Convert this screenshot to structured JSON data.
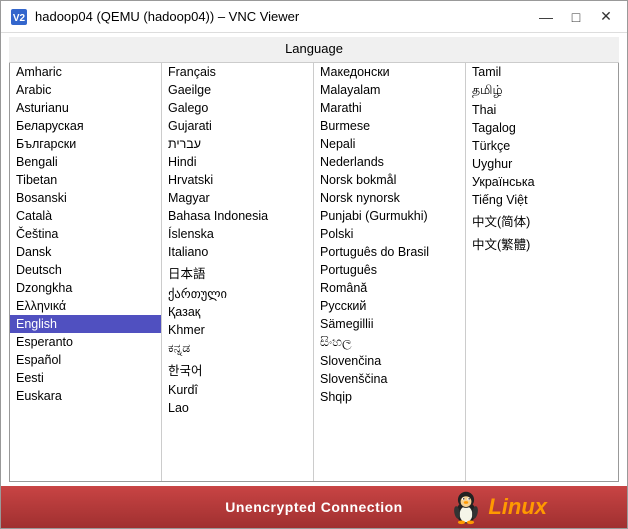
{
  "window": {
    "title": "hadoop04 (QEMU (hadoop04)) – VNC Viewer",
    "icon": "vnc-icon"
  },
  "title_buttons": {
    "minimize": "—",
    "maximize": "□",
    "close": "✕"
  },
  "language_header": "Language",
  "status": {
    "text": "Unencrypted Connection"
  },
  "columns": [
    {
      "items": [
        "Amharic",
        "Arabic",
        "Asturianu",
        "Беларуская",
        "Български",
        "Bengali",
        "Tibetan",
        "Bosanski",
        "Català",
        "Čeština",
        "Dansk",
        "Deutsch",
        "Dzongkha",
        "Ελληνικά",
        "English",
        "Esperanto",
        "Español",
        "Eesti",
        "Euskara"
      ]
    },
    {
      "items": [
        "Français",
        "Gaeilge",
        "Galego",
        "Gujarati",
        "עברית",
        "Hindi",
        "Hrvatski",
        "Magyar",
        "Bahasa Indonesia",
        "Íslenska",
        "Italiano",
        "日本語",
        "ქართული",
        "Қазақ",
        "Khmer",
        "ಕನ್ನಡ",
        "한국어",
        "Kurdî",
        "Lao"
      ]
    },
    {
      "items": [
        "Македонски",
        "Malayalam",
        "Marathi",
        "Burmese",
        "Nepali",
        "Nederlands",
        "Norsk bokmål",
        "Norsk nynorsk",
        "Punjabi (Gurmukhi)",
        "Polski",
        "Português do Brasil",
        "Português",
        "Română",
        "Русский",
        "Sämegillii",
        "සිංහල",
        "Slovenčina",
        "Slovenščina",
        "Shqip"
      ]
    },
    {
      "items": [
        "Tamil",
        "தமிழ்",
        "Thai",
        "Tagalog",
        "Türkçe",
        "Uyghur",
        "Українська",
        "Tiếng Việt",
        "中文(简体)",
        "中文(繁體)",
        "",
        "",
        "",
        "",
        "",
        "",
        "",
        "",
        ""
      ]
    }
  ]
}
